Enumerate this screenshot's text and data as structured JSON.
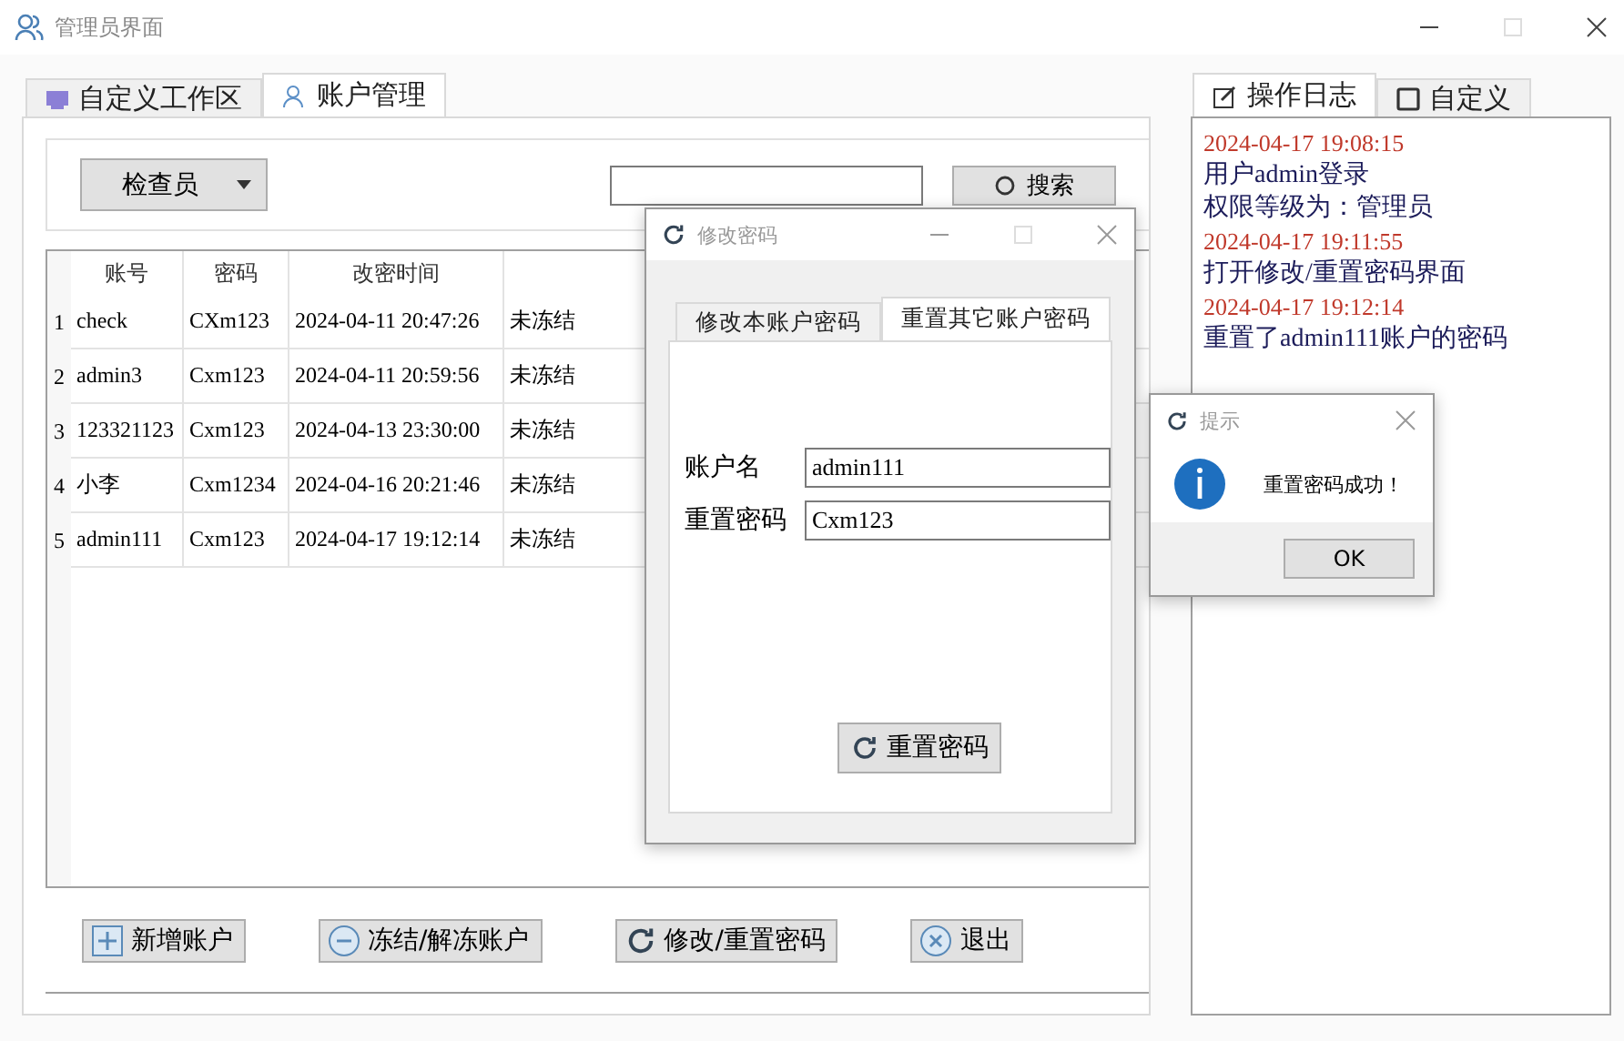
{
  "window": {
    "title": "管理员界面"
  },
  "main_tabs": [
    {
      "label": "自定义工作区",
      "selected": false,
      "kind": "workspace"
    },
    {
      "label": "账户管理",
      "selected": true,
      "kind": "users"
    }
  ],
  "role_dropdown": {
    "value": "检查员"
  },
  "search": {
    "button": "搜索"
  },
  "table": {
    "columns": [
      "账号",
      "密码",
      "改密时间"
    ],
    "rows": [
      {
        "index": "1",
        "cells": [
          "check",
          "CXm123",
          "2024-04-11 20:47:26",
          "未冻结"
        ]
      },
      {
        "index": "2",
        "cells": [
          "admin3",
          "Cxm123",
          "2024-04-11 20:59:56",
          "未冻结"
        ]
      },
      {
        "index": "3",
        "cells": [
          "123321123",
          "Cxm123",
          "2024-04-13 23:30:00",
          "未冻结"
        ]
      },
      {
        "index": "4",
        "cells": [
          "小李",
          "Cxm1234",
          "2024-04-16 20:21:46",
          "未冻结"
        ]
      },
      {
        "index": "5",
        "cells": [
          "admin111",
          "Cxm123",
          "2024-04-17 19:12:14",
          "未冻结"
        ]
      }
    ]
  },
  "actions": [
    {
      "label": "新增账户",
      "kind": "add"
    },
    {
      "label": "冻结/解冻账户",
      "kind": "freeze"
    },
    {
      "label": "修改/重置密码",
      "kind": "reset"
    },
    {
      "label": "退出",
      "kind": "exit"
    }
  ],
  "side_tabs": [
    {
      "label": "操作日志",
      "selected": true,
      "kind": "log"
    },
    {
      "label": "自定义",
      "selected": false,
      "kind": "custom"
    }
  ],
  "log": [
    {
      "kind": "time",
      "text": "2024-04-17 19:08:15"
    },
    {
      "kind": "message",
      "text": "用户admin登录"
    },
    {
      "kind": "message",
      "text": "权限等级为：管理员"
    },
    {
      "kind": "time",
      "text": "2024-04-17 19:11:55"
    },
    {
      "kind": "message",
      "text": "打开修改/重置密码界面"
    },
    {
      "kind": "time",
      "text": "2024-04-17 19:12:14"
    },
    {
      "kind": "message",
      "text": "重置了admin111账户的密码"
    }
  ],
  "password_dialog": {
    "title": "修改密码",
    "tabs": [
      {
        "label": "修改本账户密码",
        "selected": false
      },
      {
        "label": "重置其它账户密码",
        "selected": true
      }
    ],
    "fields": [
      {
        "label": "账户名",
        "value": "admin111"
      },
      {
        "label": "重置密码",
        "value": "Cxm123"
      }
    ],
    "button": "重置密码"
  },
  "message_box": {
    "title": "提示",
    "message": "重置密码成功！",
    "button": "OK"
  }
}
